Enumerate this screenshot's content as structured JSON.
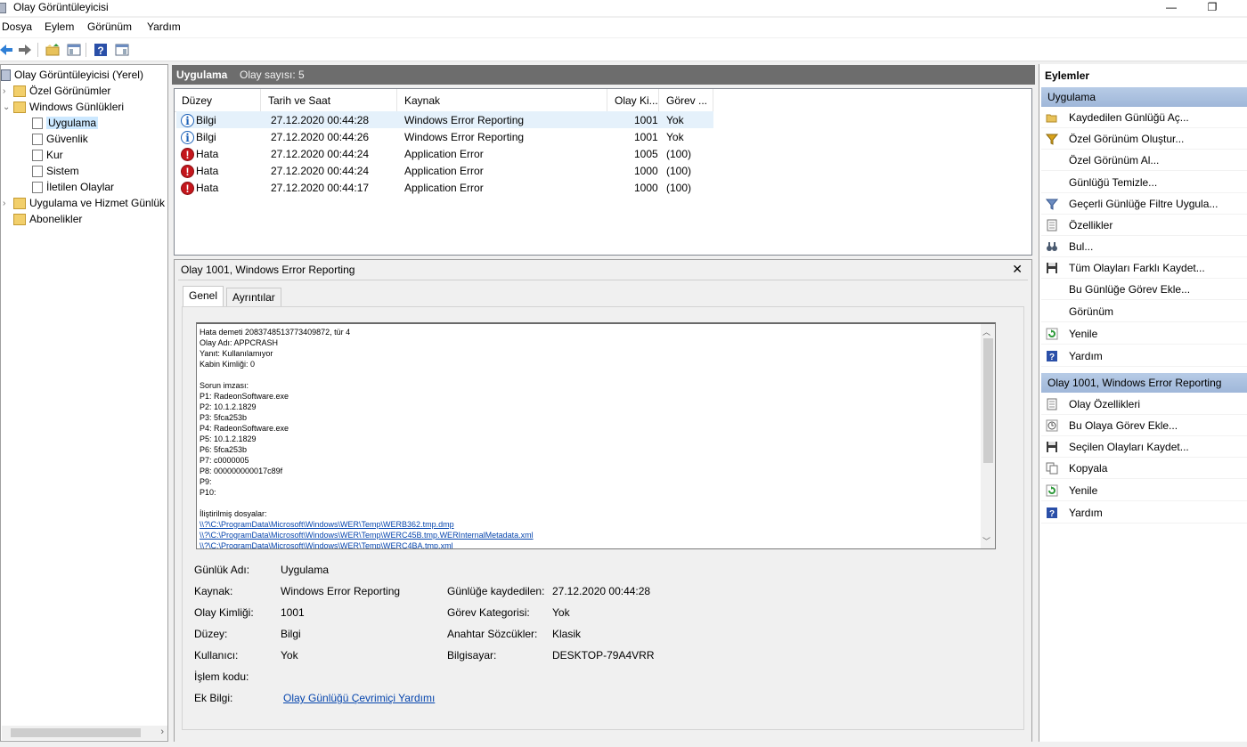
{
  "window": {
    "title": "Olay Görüntüleyicisi",
    "minimize": "—",
    "restore": "❐"
  },
  "menu": [
    "Dosya",
    "Eylem",
    "Görünüm",
    "Yardım"
  ],
  "tree": {
    "root": "Olay Görüntüleyicisi (Yerel)",
    "custom_views": "Özel Görünümler",
    "windows_logs": "Windows Günlükleri",
    "application": "Uygulama",
    "security": "Güvenlik",
    "setup": "Kur",
    "system": "Sistem",
    "forwarded": "İletilen Olaylar",
    "app_service_logs": "Uygulama ve Hizmet Günlük",
    "subscriptions": "Abonelikler"
  },
  "center": {
    "title": "Uygulama",
    "count": "Olay sayısı: 5"
  },
  "columns": [
    "Düzey",
    "Tarih ve Saat",
    "Kaynak",
    "Olay Ki...",
    "Görev ..."
  ],
  "events": [
    {
      "level": "Bilgi",
      "type": "info",
      "datetime": "27.12.2020 00:44:28",
      "source": "Windows Error Reporting",
      "id": "1001",
      "task": "Yok"
    },
    {
      "level": "Bilgi",
      "type": "info",
      "datetime": "27.12.2020 00:44:26",
      "source": "Windows Error Reporting",
      "id": "1001",
      "task": "Yok"
    },
    {
      "level": "Hata",
      "type": "err",
      "datetime": "27.12.2020 00:44:24",
      "source": "Application Error",
      "id": "1005",
      "task": "(100)"
    },
    {
      "level": "Hata",
      "type": "err",
      "datetime": "27.12.2020 00:44:24",
      "source": "Application Error",
      "id": "1000",
      "task": "(100)"
    },
    {
      "level": "Hata",
      "type": "err",
      "datetime": "27.12.2020 00:44:17",
      "source": "Application Error",
      "id": "1000",
      "task": "(100)"
    }
  ],
  "detail": {
    "title": "Olay 1001, Windows Error Reporting",
    "close": "✕",
    "tab_general": "Genel",
    "tab_details": "Ayrıntılar",
    "description_lines": [
      "Hata demeti 2083748513773409872, tür 4",
      "Olay Adı: APPCRASH",
      "Yanıt: Kullanılamıyor",
      "Kabin Kimliği: 0",
      "",
      "Sorun imzası:",
      "P1: RadeonSoftware.exe",
      "P2: 10.1.2.1829",
      "P3: 5fca253b",
      "P4: RadeonSoftware.exe",
      "P5: 10.1.2.1829",
      "P6: 5fca253b",
      "P7: c0000005",
      "P8: 000000000017c89f",
      "P9:",
      "P10:",
      "",
      "İliştirilmiş dosyalar:"
    ],
    "description_links": [
      "\\\\?\\C:\\ProgramData\\Microsoft\\Windows\\WER\\Temp\\WERB362.tmp.dmp",
      "\\\\?\\C:\\ProgramData\\Microsoft\\Windows\\WER\\Temp\\WERC45B.tmp.WERInternalMetadata.xml",
      "\\\\?\\C:\\ProgramData\\Microsoft\\Windows\\WER\\Temp\\WERC4BA.tmp.xml"
    ],
    "labels": {
      "log_name": "Günlük Adı:",
      "source": "Kaynak:",
      "event_id": "Olay Kimliği:",
      "level": "Düzey:",
      "user": "Kullanıcı:",
      "opcode": "İşlem kodu:",
      "more_info": "Ek Bilgi:",
      "logged": "Günlüğe kaydedilen:",
      "task_category": "Görev Kategorisi:",
      "keywords": "Anahtar Sözcükler:",
      "computer": "Bilgisayar:"
    },
    "values": {
      "log_name": "Uygulama",
      "source": "Windows Error Reporting",
      "event_id": "1001",
      "level": "Bilgi",
      "user": "Yok",
      "opcode": "",
      "more_info": "Olay Günlüğü Çevrimiçi Yardımı",
      "logged": "27.12.2020 00:44:28",
      "task_category": "Yok",
      "keywords": "Klasik",
      "computer": "DESKTOP-79A4VRR"
    }
  },
  "actions": {
    "title": "Eylemler",
    "section1": "Uygulama",
    "items1": [
      "Kaydedilen Günlüğü Aç...",
      "Özel Görünüm Oluştur...",
      "Özel Görünüm Al...",
      "Günlüğü Temizle...",
      "Geçerli Günlüğe Filtre Uygula...",
      "Özellikler",
      "Bul...",
      "Tüm Olayları Farklı Kaydet...",
      "Bu Günlüğe Görev Ekle...",
      "Görünüm",
      "Yenile",
      "Yardım"
    ],
    "section2": "Olay 1001, Windows Error Reporting",
    "items2": [
      "Olay Özellikleri",
      "Bu Olaya Görev Ekle...",
      "Seçilen Olayları Kaydet...",
      "Kopyala",
      "Yenile",
      "Yardım"
    ]
  },
  "colors": {
    "accent": "#1f63b8",
    "error": "#c4161c",
    "header": "#6d6d6d",
    "selection": "#cce8ff",
    "section": "#9fb7d9"
  }
}
